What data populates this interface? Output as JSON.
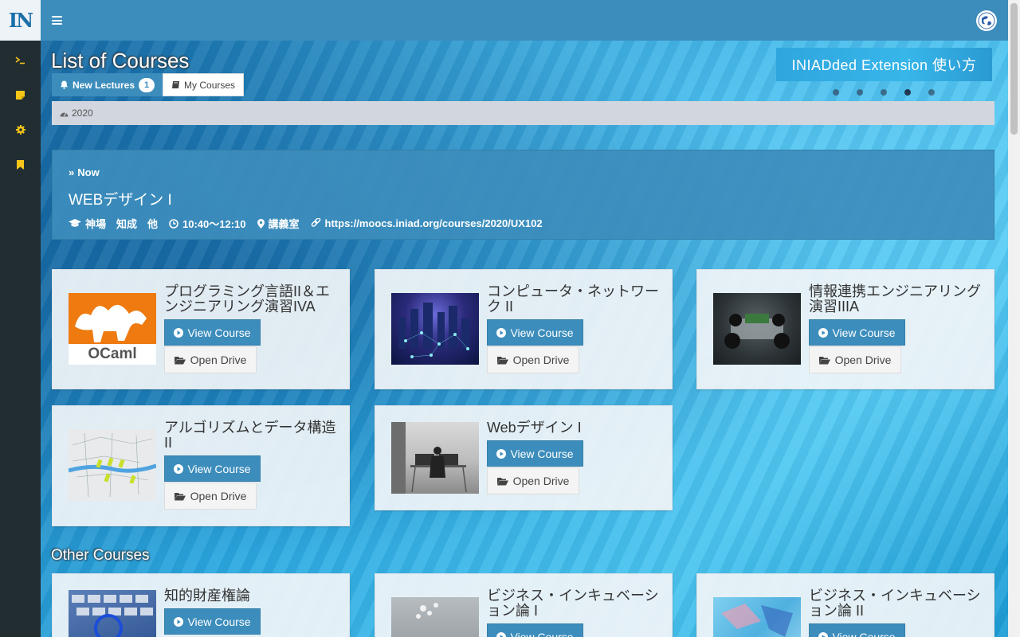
{
  "app": {
    "logo_text": "IN"
  },
  "sidebar": {
    "items": [
      {
        "icon": "terminal-icon"
      },
      {
        "icon": "sticky-note-icon"
      },
      {
        "icon": "gear-icon"
      },
      {
        "icon": "bookmark-icon"
      }
    ]
  },
  "header": {
    "menu_icon": "hamburger-icon",
    "right_icon": "globe-icon"
  },
  "page": {
    "title": "List of Courses",
    "tabs": [
      {
        "label": "New Lectures",
        "badge": "1",
        "icon": "bell-icon",
        "active": true
      },
      {
        "label": "My Courses",
        "icon": "book-icon",
        "active": false
      }
    ],
    "banner_text": "INIADded Extension 使い方",
    "carousel_dots": 5,
    "year": "2020"
  },
  "now": {
    "label": "Now",
    "title": "WEBデザイン I",
    "teacher": "神場　知成　他",
    "time": "10:40〜12:10",
    "room": "講義室",
    "url": "https://moocs.iniad.org/courses/2020/UX102"
  },
  "my_courses": [
    {
      "title": "プログラミング言語II＆エンジニアリング演習IVA",
      "thumb": "ocaml-logo",
      "thumb_text": "OCaml",
      "view_label": "View Course",
      "drive_label": "Open Drive"
    },
    {
      "title": "コンピュータ・ネットワーク II",
      "thumb": "network-city",
      "view_label": "View Course",
      "drive_label": "Open Drive"
    },
    {
      "title": "情報連携エンジニアリング演習IIIA",
      "thumb": "robot-car",
      "view_label": "View Course",
      "drive_label": "Open Drive"
    },
    {
      "title": "アルゴリズムとデータ構造 II",
      "thumb": "city-map",
      "view_label": "View Course",
      "drive_label": "Open Drive"
    },
    {
      "title": "Webデザイン I",
      "thumb": "workspace-photo",
      "view_label": "View Course",
      "drive_label": "Open Drive"
    }
  ],
  "other_courses_title": "Other Courses",
  "other_courses": [
    {
      "title": "知的財産権論",
      "thumb": "keyboard-copyright",
      "view_label": "View Course"
    },
    {
      "title": "ビジネス・インキュベーション論 I",
      "thumb": "cherry-blossom",
      "view_label": "View Course"
    },
    {
      "title": "ビジネス・インキュベーション論 II",
      "thumb": "abstract-blue",
      "view_label": "View Course"
    }
  ],
  "colors": {
    "primary": "#3c8dbc",
    "sidebar": "#222d32",
    "accent": "#f5c518"
  }
}
